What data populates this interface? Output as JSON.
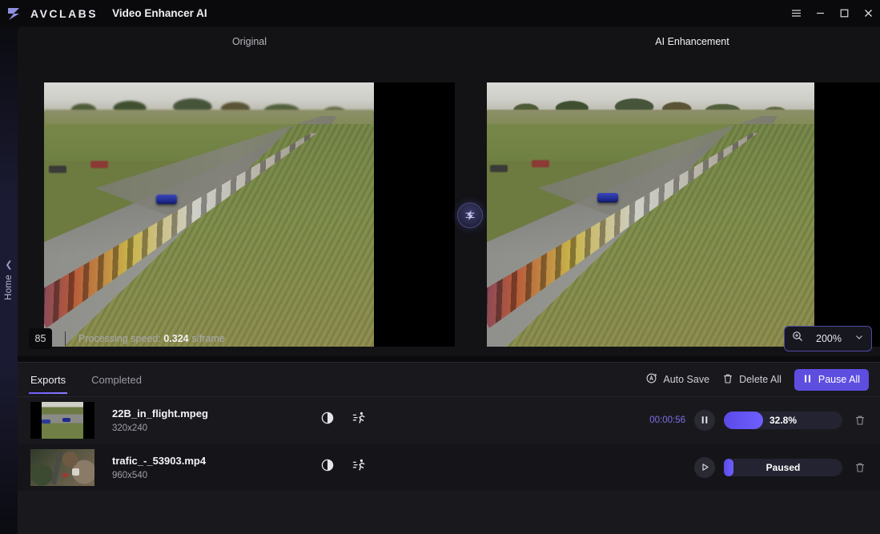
{
  "titlebar": {
    "logo_icon": "avclabs-logo-icon",
    "brand": "AVCLABS",
    "app_title": "Video Enhancer AI",
    "menu_icon": "hamburger-menu-icon",
    "minimize_icon": "minimize-icon",
    "maximize_icon": "maximize-icon",
    "close_icon": "close-icon"
  },
  "left_rail": {
    "chevron_icon": "chevron-left-icon",
    "label": "Home"
  },
  "preview": {
    "original_label": "Original",
    "enhanced_label": "AI Enhancement",
    "flash_icon": "flash-bolt-icon"
  },
  "status": {
    "frame_number": "85",
    "speed_prefix": "Processing speed:",
    "speed_value": "0.324",
    "speed_unit": "s/frame",
    "zoom_icon": "zoom-in-icon",
    "zoom_value": "200%",
    "zoom_chevron_icon": "chevron-down-icon"
  },
  "tabs": [
    {
      "label": "Exports",
      "active": true
    },
    {
      "label": "Completed",
      "active": false
    }
  ],
  "toolbar": {
    "auto_save_label": "Auto Save",
    "auto_save_icon": "auto-save-icon",
    "delete_all_label": "Delete All",
    "delete_all_icon": "trash-icon",
    "pause_all_label": "Pause All",
    "pause_all_icon": "pause-icon"
  },
  "files": [
    {
      "name": "22B_in_flight.mpeg",
      "resolution": "320x240",
      "contrast_icon": "contrast-icon",
      "motion_icon": "motion-running-icon",
      "time": "00:00:56",
      "control_icon": "pause-icon",
      "progress_percent": 32.8,
      "progress_label": "32.8%",
      "delete_icon": "trash-icon"
    },
    {
      "name": "trafic_-_53903.mp4",
      "resolution": "960x540",
      "contrast_icon": "contrast-icon",
      "motion_icon": "motion-running-icon",
      "time": "",
      "control_icon": "play-icon",
      "progress_percent": 8,
      "progress_label": "Paused",
      "delete_icon": "trash-icon"
    }
  ],
  "colors": {
    "accent": "#5d4ee0",
    "accent_light": "#7b6ee8",
    "panel": "#19191d",
    "background": "#0b0b0d"
  }
}
